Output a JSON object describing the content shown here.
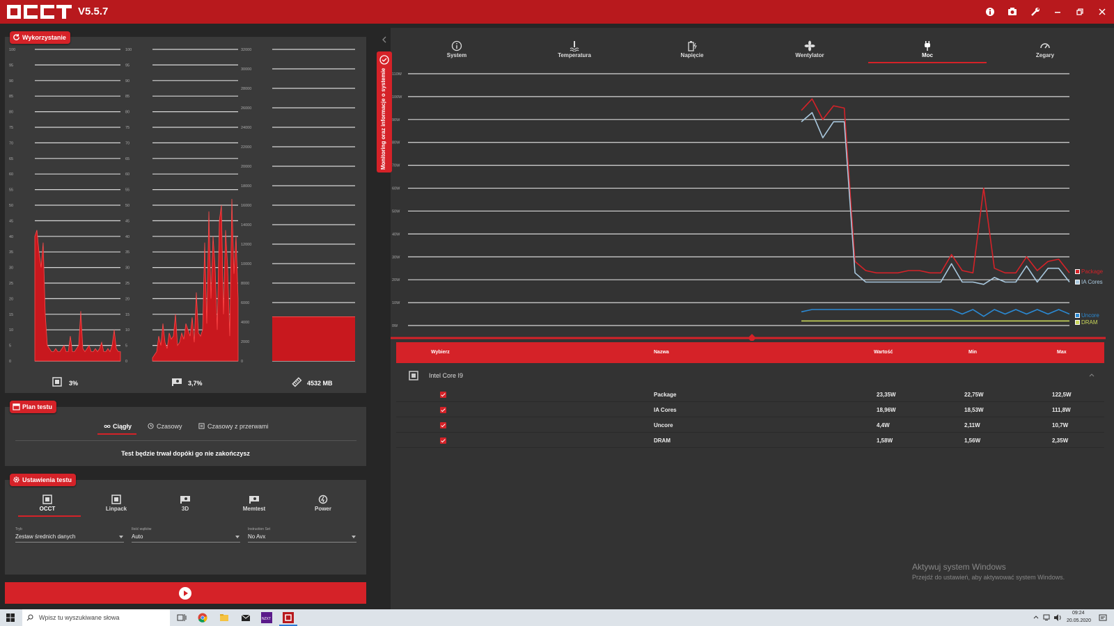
{
  "app": {
    "version": "V5.5.7",
    "accent": "#d52228",
    "titlebar": "#b8191d"
  },
  "usage": {
    "title": "Wykorzystanie",
    "cpu_value": "3%",
    "gpu_value": "3,7%",
    "mem_value": "4532 MB",
    "pct_ticks": [
      "100",
      "95",
      "90",
      "85",
      "80",
      "75",
      "70",
      "65",
      "60",
      "55",
      "50",
      "45",
      "40",
      "35",
      "30",
      "25",
      "20",
      "15",
      "10",
      "5",
      "0"
    ],
    "mem_ticks": [
      "32000",
      "30000",
      "28000",
      "26000",
      "24000",
      "22000",
      "20000",
      "18000",
      "16000",
      "14000",
      "12000",
      "10000",
      "8000",
      "6000",
      "4000",
      "2000",
      "0"
    ]
  },
  "plan": {
    "title": "Plan testu",
    "modes": [
      "Ciągły",
      "Czasowy",
      "Czasowy z przerwami"
    ],
    "description": "Test będzie trwał dopóki go nie zakończysz"
  },
  "settings": {
    "title": "Ustawienia testu",
    "tabs": [
      "OCCT",
      "Linpack",
      "3D",
      "Memtest",
      "Power"
    ],
    "fields": [
      {
        "label": "Tryb",
        "value": "Zestaw średnich danych"
      },
      {
        "label": "Ilość wątków",
        "value": "Auto"
      },
      {
        "label": "Instruction Set",
        "value": "No Avx"
      }
    ]
  },
  "side_tab": "Monitoring oraz informacje o systemie",
  "monitor": {
    "tabs": [
      "System",
      "Temperatura",
      "Napięcie",
      "Wentylator",
      "Moc",
      "Zegary"
    ],
    "active_tab": "Moc",
    "y_ticks": [
      "110W",
      "100W",
      "90W",
      "80W",
      "70W",
      "60W",
      "50W",
      "40W",
      "30W",
      "20W",
      "10W",
      "0W"
    ],
    "legend": [
      "Package",
      "IA Cores",
      "Uncore",
      "DRAM"
    ],
    "colors": {
      "package": "#d52228",
      "ia": "#a9c8de",
      "uncore": "#2b8ad4",
      "dram": "#c9d65a"
    }
  },
  "chart_data": {
    "type": "line",
    "ylabel": "",
    "ylim": [
      0,
      110
    ],
    "series": [
      {
        "name": "Package",
        "values": [
          94,
          99,
          90,
          96,
          95,
          28,
          24,
          23,
          23,
          23,
          24,
          24,
          23,
          23,
          31,
          24,
          23,
          60,
          25,
          23,
          23,
          30,
          24,
          28,
          29,
          23
        ]
      },
      {
        "name": "IA Cores",
        "values": [
          89,
          93,
          82,
          89,
          89,
          23,
          19,
          19,
          19,
          19,
          19,
          19,
          19,
          19,
          27,
          19,
          19,
          18,
          21,
          19,
          19,
          26,
          19,
          25,
          25,
          19
        ]
      },
      {
        "name": "Uncore",
        "values": [
          6,
          7,
          7,
          7,
          7,
          7,
          7,
          7,
          7,
          7,
          7,
          7,
          7,
          7,
          7,
          5,
          7,
          4,
          7,
          5,
          7,
          5,
          7,
          5,
          7,
          5
        ]
      },
      {
        "name": "DRAM",
        "values": [
          2,
          2,
          2,
          2,
          2,
          2,
          2,
          2,
          2,
          2,
          2,
          2,
          2,
          2,
          2,
          2,
          2,
          2,
          2,
          2,
          2,
          2,
          2,
          2,
          2,
          2
        ]
      }
    ]
  },
  "table": {
    "headers": [
      "Wybierz",
      "Nazwa",
      "Wartość",
      "Min",
      "Max"
    ],
    "group": "Intel Core I9",
    "rows": [
      {
        "name": "Package",
        "value": "23,35W",
        "min": "22,75W",
        "max": "122,5W"
      },
      {
        "name": "IA Cores",
        "value": "18,96W",
        "min": "18,53W",
        "max": "111,8W"
      },
      {
        "name": "Uncore",
        "value": "4,4W",
        "min": "2,11W",
        "max": "10,7W"
      },
      {
        "name": "DRAM",
        "value": "1,58W",
        "min": "1,56W",
        "max": "2,35W"
      }
    ]
  },
  "watermark": {
    "line1": "Aktywuj system Windows",
    "line2": "Przejdź do ustawień, aby aktywować system Windows."
  },
  "taskbar": {
    "search_placeholder": "Wpisz tu wyszukiwane słowa",
    "time": "09:24",
    "date": "20.05.2020"
  }
}
